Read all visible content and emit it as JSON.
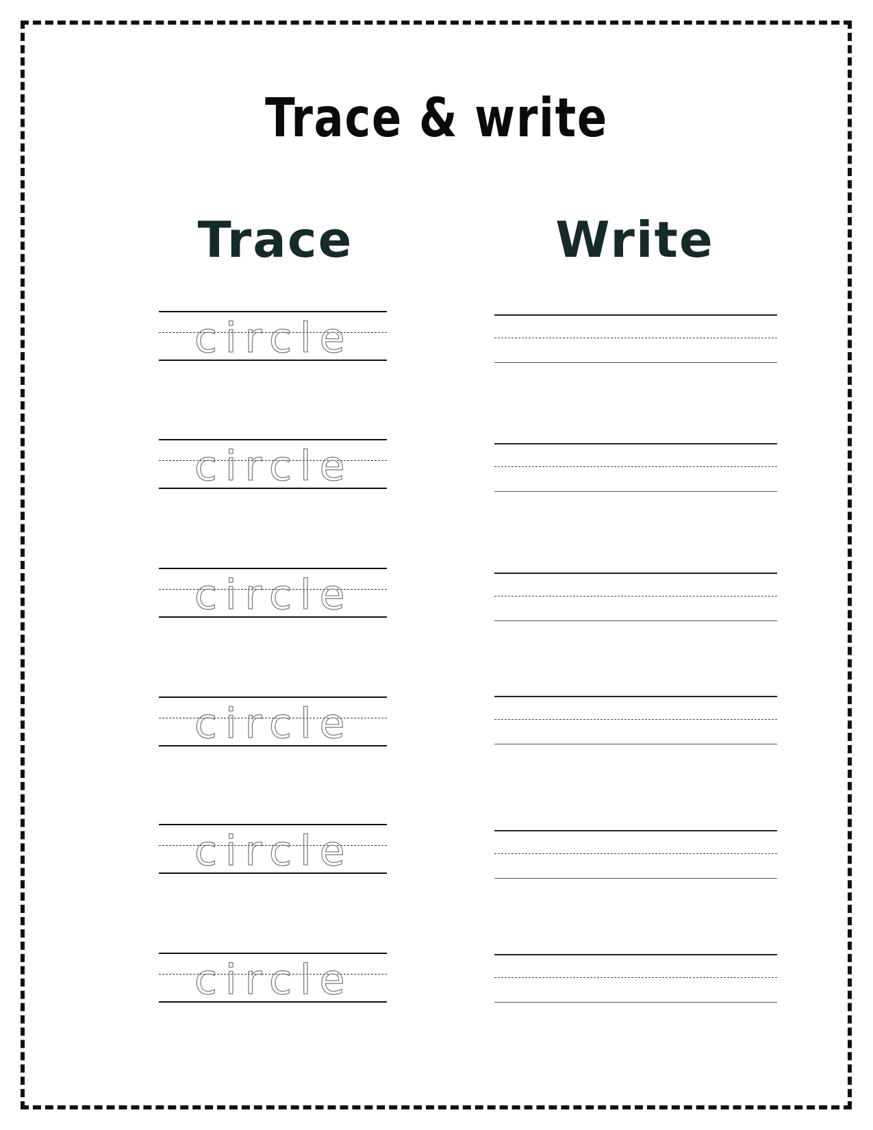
{
  "worksheet": {
    "title": "Trace & write",
    "columns": {
      "trace_heading": "Trace",
      "write_heading": "Write"
    },
    "trace_words": [
      "circle",
      "circle",
      "circle",
      "circle",
      "circle",
      "circle"
    ]
  }
}
